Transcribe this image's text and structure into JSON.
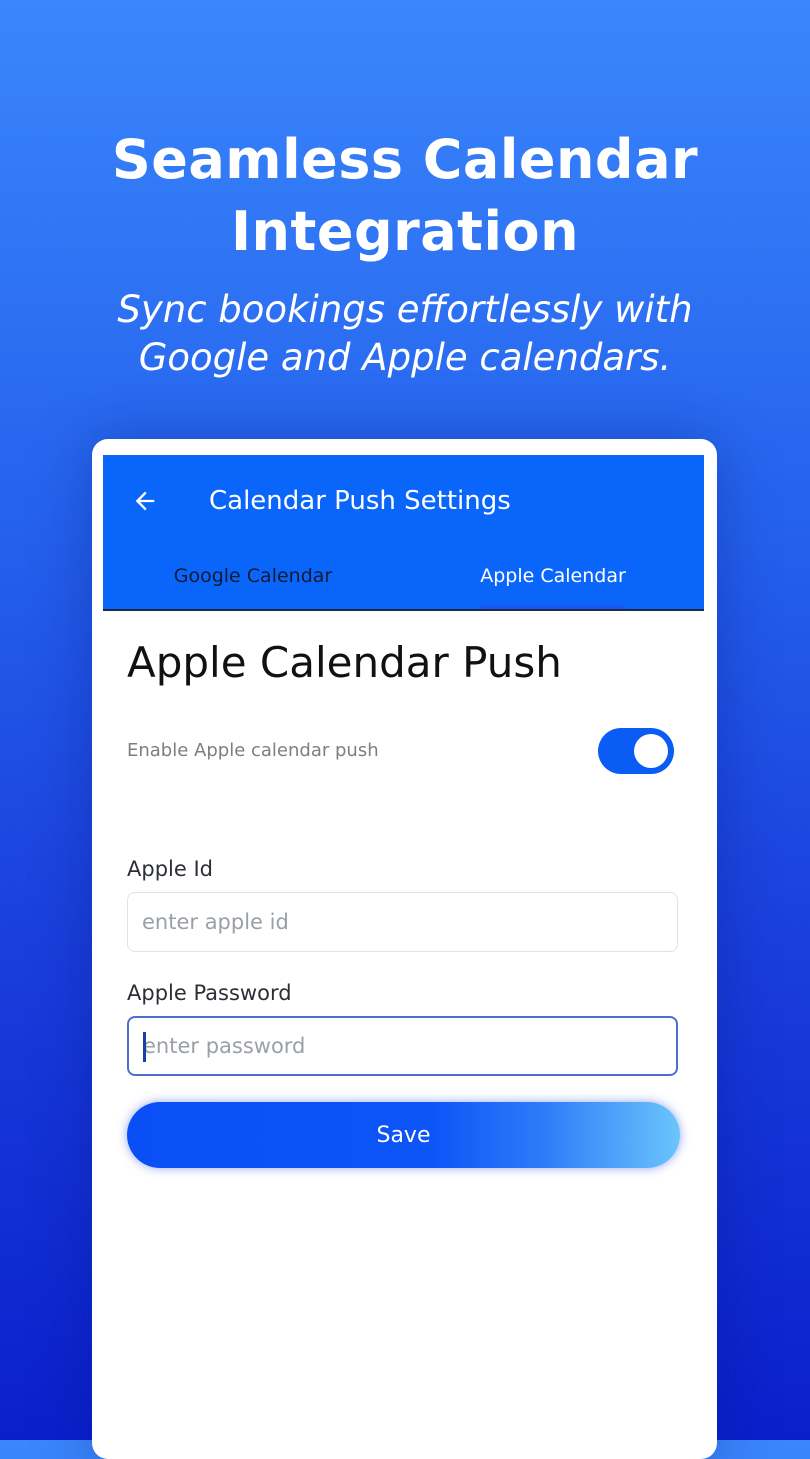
{
  "promo": {
    "headline_line1": "Seamless Calendar",
    "headline_line2": "Integration",
    "subline_line1": "Sync bookings effortlessly with",
    "subline_line2": "Google and Apple calendars."
  },
  "appbar": {
    "title": "Calendar Push Settings",
    "back_icon": "arrow-left-icon",
    "color": "#0a66fb"
  },
  "tabs": [
    {
      "label": "Google Calendar",
      "selected": false
    },
    {
      "label": "Apple Calendar",
      "selected": true
    }
  ],
  "apple_push": {
    "title": "Apple Calendar Push",
    "toggle_label": "Enable Apple calendar push",
    "toggle_on": true,
    "apple_id": {
      "label": "Apple Id",
      "placeholder": "enter apple id",
      "value": ""
    },
    "password": {
      "label": "Apple Password",
      "placeholder": "enter password",
      "value": "",
      "focused": true
    },
    "save_label": "Save"
  },
  "colors": {
    "accent": "#0a5cf5",
    "background_top": "#3a86fb",
    "background_bottom": "#0a1fcc"
  }
}
